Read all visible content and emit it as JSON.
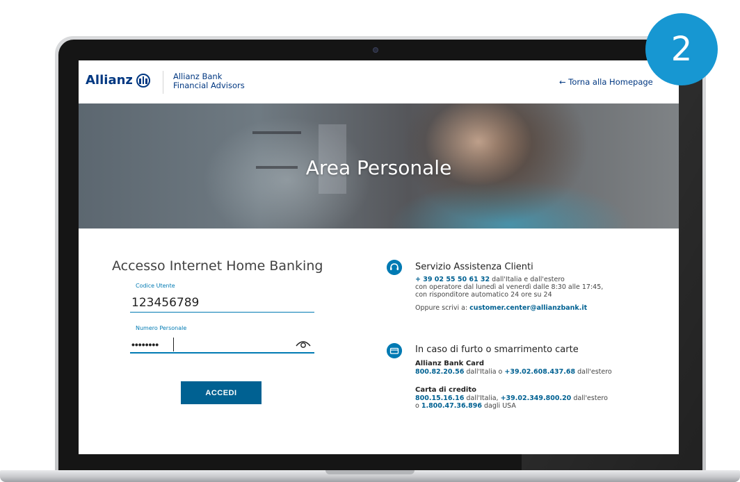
{
  "header": {
    "logo_text": "Allianz",
    "brand_line1": "Allianz Bank",
    "brand_line2": "Financial Advisors",
    "back_link": "← Torna alla Homepage"
  },
  "hero": {
    "title": "Area Personale"
  },
  "login": {
    "title": "Accesso Internet Home Banking",
    "username_label": "Codice Utente",
    "username_value": "123456789",
    "password_label": "Numero Personale",
    "password_value": "••••••••",
    "submit_label": "ACCEDI"
  },
  "assistance": {
    "title": "Servizio Assistenza Clienti",
    "phone": "+ 39 02 55 50 61 32",
    "phone_suffix": " dall'Italia e dall'estero",
    "line2": "con operatore dal lunedì al venerdì dalle 8:30 alle 17:45,",
    "line3": "con risponditore automatico 24 ore su 24",
    "email_prefix": "Oppure scrivi a: ",
    "email": "customer.center@allianzbank.it"
  },
  "theft": {
    "title": "In caso di furto o smarrimento carte",
    "card_heading": "Allianz Bank Card",
    "card_phone_it": "800.82.20.56",
    "card_mid": " dall'Italia o ",
    "card_phone_abroad": "+39.02.608.437.68",
    "card_suffix": " dall'estero",
    "credit_heading": "Carta di credito",
    "credit_phone_it": "800.15.16.16",
    "credit_mid": " dall'Italia, ",
    "credit_phone_abroad": "+39.02.349.800.20",
    "credit_suffix": " dall'estero",
    "credit_line2_prefix": "o ",
    "credit_phone_usa": "1.800.47.36.896",
    "credit_line2_suffix": " dagli USA"
  },
  "badge": {
    "step": "2"
  },
  "colors": {
    "brand_blue": "#003781",
    "accent_blue": "#007ab3",
    "button_blue": "#006192",
    "badge_blue": "#1797d2"
  }
}
